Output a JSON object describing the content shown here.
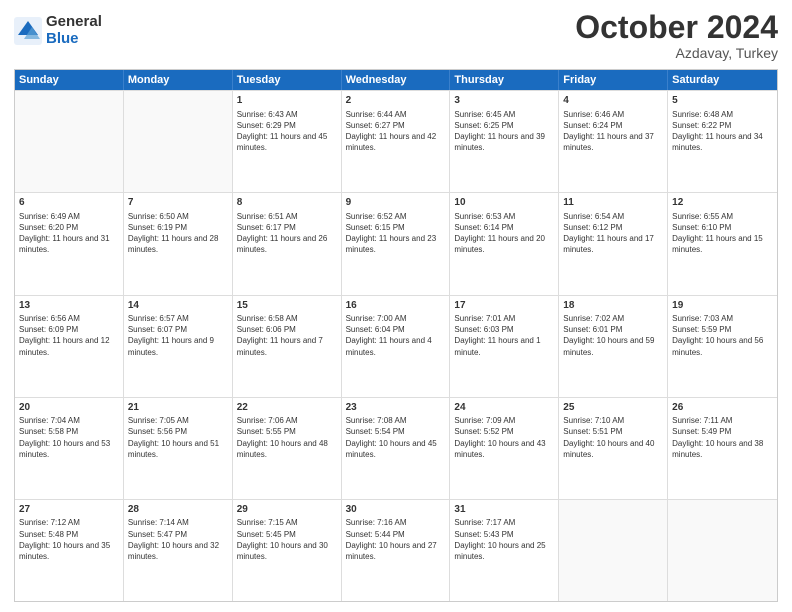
{
  "logo": {
    "general": "General",
    "blue": "Blue"
  },
  "title": {
    "month": "October 2024",
    "location": "Azdavay, Turkey"
  },
  "header_days": [
    "Sunday",
    "Monday",
    "Tuesday",
    "Wednesday",
    "Thursday",
    "Friday",
    "Saturday"
  ],
  "weeks": [
    [
      {
        "day": "",
        "sunrise": "",
        "sunset": "",
        "daylight": ""
      },
      {
        "day": "",
        "sunrise": "",
        "sunset": "",
        "daylight": ""
      },
      {
        "day": "1",
        "sunrise": "Sunrise: 6:43 AM",
        "sunset": "Sunset: 6:29 PM",
        "daylight": "Daylight: 11 hours and 45 minutes."
      },
      {
        "day": "2",
        "sunrise": "Sunrise: 6:44 AM",
        "sunset": "Sunset: 6:27 PM",
        "daylight": "Daylight: 11 hours and 42 minutes."
      },
      {
        "day": "3",
        "sunrise": "Sunrise: 6:45 AM",
        "sunset": "Sunset: 6:25 PM",
        "daylight": "Daylight: 11 hours and 39 minutes."
      },
      {
        "day": "4",
        "sunrise": "Sunrise: 6:46 AM",
        "sunset": "Sunset: 6:24 PM",
        "daylight": "Daylight: 11 hours and 37 minutes."
      },
      {
        "day": "5",
        "sunrise": "Sunrise: 6:48 AM",
        "sunset": "Sunset: 6:22 PM",
        "daylight": "Daylight: 11 hours and 34 minutes."
      }
    ],
    [
      {
        "day": "6",
        "sunrise": "Sunrise: 6:49 AM",
        "sunset": "Sunset: 6:20 PM",
        "daylight": "Daylight: 11 hours and 31 minutes."
      },
      {
        "day": "7",
        "sunrise": "Sunrise: 6:50 AM",
        "sunset": "Sunset: 6:19 PM",
        "daylight": "Daylight: 11 hours and 28 minutes."
      },
      {
        "day": "8",
        "sunrise": "Sunrise: 6:51 AM",
        "sunset": "Sunset: 6:17 PM",
        "daylight": "Daylight: 11 hours and 26 minutes."
      },
      {
        "day": "9",
        "sunrise": "Sunrise: 6:52 AM",
        "sunset": "Sunset: 6:15 PM",
        "daylight": "Daylight: 11 hours and 23 minutes."
      },
      {
        "day": "10",
        "sunrise": "Sunrise: 6:53 AM",
        "sunset": "Sunset: 6:14 PM",
        "daylight": "Daylight: 11 hours and 20 minutes."
      },
      {
        "day": "11",
        "sunrise": "Sunrise: 6:54 AM",
        "sunset": "Sunset: 6:12 PM",
        "daylight": "Daylight: 11 hours and 17 minutes."
      },
      {
        "day": "12",
        "sunrise": "Sunrise: 6:55 AM",
        "sunset": "Sunset: 6:10 PM",
        "daylight": "Daylight: 11 hours and 15 minutes."
      }
    ],
    [
      {
        "day": "13",
        "sunrise": "Sunrise: 6:56 AM",
        "sunset": "Sunset: 6:09 PM",
        "daylight": "Daylight: 11 hours and 12 minutes."
      },
      {
        "day": "14",
        "sunrise": "Sunrise: 6:57 AM",
        "sunset": "Sunset: 6:07 PM",
        "daylight": "Daylight: 11 hours and 9 minutes."
      },
      {
        "day": "15",
        "sunrise": "Sunrise: 6:58 AM",
        "sunset": "Sunset: 6:06 PM",
        "daylight": "Daylight: 11 hours and 7 minutes."
      },
      {
        "day": "16",
        "sunrise": "Sunrise: 7:00 AM",
        "sunset": "Sunset: 6:04 PM",
        "daylight": "Daylight: 11 hours and 4 minutes."
      },
      {
        "day": "17",
        "sunrise": "Sunrise: 7:01 AM",
        "sunset": "Sunset: 6:03 PM",
        "daylight": "Daylight: 11 hours and 1 minute."
      },
      {
        "day": "18",
        "sunrise": "Sunrise: 7:02 AM",
        "sunset": "Sunset: 6:01 PM",
        "daylight": "Daylight: 10 hours and 59 minutes."
      },
      {
        "day": "19",
        "sunrise": "Sunrise: 7:03 AM",
        "sunset": "Sunset: 5:59 PM",
        "daylight": "Daylight: 10 hours and 56 minutes."
      }
    ],
    [
      {
        "day": "20",
        "sunrise": "Sunrise: 7:04 AM",
        "sunset": "Sunset: 5:58 PM",
        "daylight": "Daylight: 10 hours and 53 minutes."
      },
      {
        "day": "21",
        "sunrise": "Sunrise: 7:05 AM",
        "sunset": "Sunset: 5:56 PM",
        "daylight": "Daylight: 10 hours and 51 minutes."
      },
      {
        "day": "22",
        "sunrise": "Sunrise: 7:06 AM",
        "sunset": "Sunset: 5:55 PM",
        "daylight": "Daylight: 10 hours and 48 minutes."
      },
      {
        "day": "23",
        "sunrise": "Sunrise: 7:08 AM",
        "sunset": "Sunset: 5:54 PM",
        "daylight": "Daylight: 10 hours and 45 minutes."
      },
      {
        "day": "24",
        "sunrise": "Sunrise: 7:09 AM",
        "sunset": "Sunset: 5:52 PM",
        "daylight": "Daylight: 10 hours and 43 minutes."
      },
      {
        "day": "25",
        "sunrise": "Sunrise: 7:10 AM",
        "sunset": "Sunset: 5:51 PM",
        "daylight": "Daylight: 10 hours and 40 minutes."
      },
      {
        "day": "26",
        "sunrise": "Sunrise: 7:11 AM",
        "sunset": "Sunset: 5:49 PM",
        "daylight": "Daylight: 10 hours and 38 minutes."
      }
    ],
    [
      {
        "day": "27",
        "sunrise": "Sunrise: 7:12 AM",
        "sunset": "Sunset: 5:48 PM",
        "daylight": "Daylight: 10 hours and 35 minutes."
      },
      {
        "day": "28",
        "sunrise": "Sunrise: 7:14 AM",
        "sunset": "Sunset: 5:47 PM",
        "daylight": "Daylight: 10 hours and 32 minutes."
      },
      {
        "day": "29",
        "sunrise": "Sunrise: 7:15 AM",
        "sunset": "Sunset: 5:45 PM",
        "daylight": "Daylight: 10 hours and 30 minutes."
      },
      {
        "day": "30",
        "sunrise": "Sunrise: 7:16 AM",
        "sunset": "Sunset: 5:44 PM",
        "daylight": "Daylight: 10 hours and 27 minutes."
      },
      {
        "day": "31",
        "sunrise": "Sunrise: 7:17 AM",
        "sunset": "Sunset: 5:43 PM",
        "daylight": "Daylight: 10 hours and 25 minutes."
      },
      {
        "day": "",
        "sunrise": "",
        "sunset": "",
        "daylight": ""
      },
      {
        "day": "",
        "sunrise": "",
        "sunset": "",
        "daylight": ""
      }
    ]
  ]
}
